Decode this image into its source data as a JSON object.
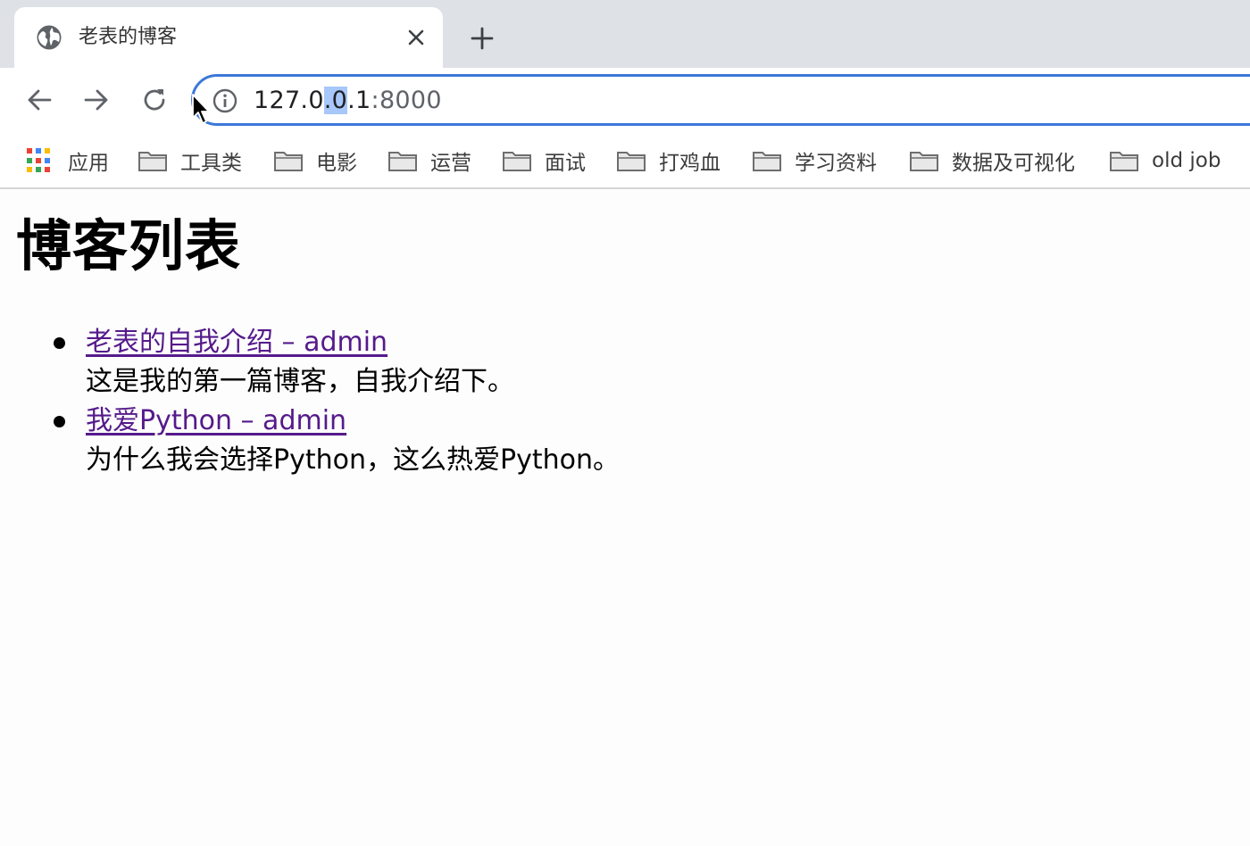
{
  "tab": {
    "title": "老表的博客",
    "favicon": "globe-icon"
  },
  "toolbar": {
    "url_prefix": "127.0",
    "url_selected": ".0",
    "url_middle": ".1",
    "url_port": ":8000"
  },
  "bookmarks": [
    {
      "label": "应用",
      "icon": "apps-grid-icon"
    },
    {
      "label": "工具类",
      "icon": "folder-icon"
    },
    {
      "label": "电影",
      "icon": "folder-icon"
    },
    {
      "label": "运营",
      "icon": "folder-icon"
    },
    {
      "label": "面试",
      "icon": "folder-icon"
    },
    {
      "label": "打鸡血",
      "icon": "folder-icon"
    },
    {
      "label": "学习资料",
      "icon": "folder-icon"
    },
    {
      "label": "数据及可视化",
      "icon": "folder-icon"
    },
    {
      "label": "old job",
      "icon": "folder-icon"
    }
  ],
  "page": {
    "title": "博客列表",
    "posts": [
      {
        "link": "老表的自我介绍 – admin",
        "desc": "这是我的第一篇博客，自我介绍下。"
      },
      {
        "link": "我爱Python – admin",
        "desc": "为什么我会选择Python，这么热爱Python。"
      }
    ]
  },
  "colors": {
    "accent": "#3c78d8",
    "visited_link": "#551a8b",
    "tabstrip_bg": "#dee1e6"
  }
}
